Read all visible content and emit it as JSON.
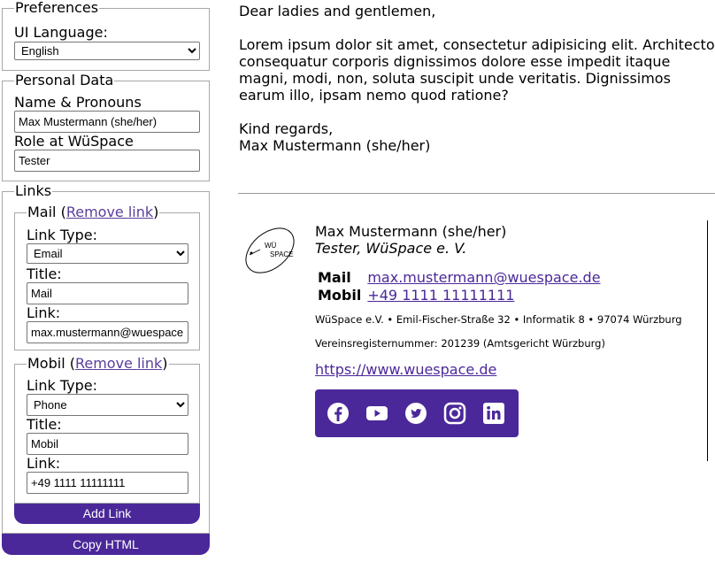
{
  "sidebar": {
    "preferences": {
      "legend": "Preferences",
      "ui_language_label": "UI Language:",
      "ui_language_value": "English"
    },
    "personal": {
      "legend": "Personal Data",
      "name_label": "Name & Pronouns",
      "name_value": "Max Mustermann (she/her)",
      "role_label": "Role at WüSpace",
      "role_value": "Tester"
    },
    "links": {
      "legend": "Links",
      "remove_label": "Remove link",
      "link_type_label": "Link Type:",
      "title_label": "Title:",
      "link_label": "Link:",
      "items": [
        {
          "legend": "Mail",
          "type": "Email",
          "title": "Mail",
          "link": "max.mustermann@wuespace.de"
        },
        {
          "legend": "Mobil",
          "type": "Phone",
          "title": "Mobil",
          "link": "+49 1111 11111111"
        }
      ],
      "add_button": "Add Link"
    },
    "copy_button": "Copy HTML"
  },
  "letter": {
    "greeting": "Dear ladies and gentlemen,",
    "body": "Lorem ipsum dolor sit amet, consectetur adipisicing elit. Architecto consequatur corporis dignissimos dolore esse impedit itaque magni, modi, non, soluta suscipit unde veritatis. Dignissimos earum illo, ipsam nemo quod ratione?",
    "closing": "Kind regards,",
    "signer": "Max Mustermann (she/her)"
  },
  "signature": {
    "logo_text": "WÜ SPACE",
    "name": "Max Mustermann (she/her)",
    "role": "Tester, WüSpace e. V.",
    "links": [
      {
        "key": "Mail",
        "value": "max.mustermann@wuespace.de"
      },
      {
        "key": "Mobil",
        "value": "+49 1111 11111111"
      }
    ],
    "address": "WüSpace e.V. • Emil-Fischer-Straße 32 • Informatik 8 • 97074 Würzburg",
    "register": "Vereinsregisternummer: 201239 (Amtsgericht Würzburg)",
    "website": "https://www.wuespace.de",
    "social_icons": [
      "facebook-icon",
      "youtube-icon",
      "twitter-icon",
      "instagram-icon",
      "linkedin-icon"
    ]
  },
  "colors": {
    "accent": "#4b2899",
    "link": "#5a3d9c"
  }
}
